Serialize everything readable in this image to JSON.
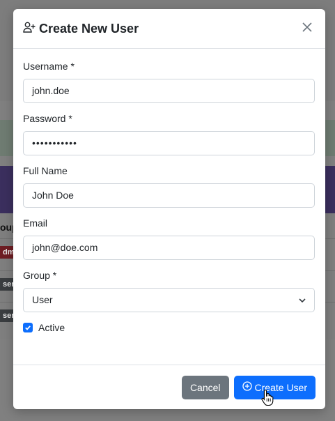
{
  "background": {
    "heading_fragment": "oup",
    "badges": [
      "dmi",
      "ser",
      "ser"
    ]
  },
  "modal": {
    "title": "Create New User",
    "title_icon": "user-plus-icon",
    "close_icon": "close-icon",
    "fields": {
      "username": {
        "label": "Username *",
        "value": "john.doe"
      },
      "password": {
        "label": "Password *",
        "value": "•••••••••••"
      },
      "full_name": {
        "label": "Full Name",
        "value": "John Doe"
      },
      "email": {
        "label": "Email",
        "value": "john@doe.com"
      },
      "group": {
        "label": "Group *",
        "selected": "User"
      }
    },
    "active": {
      "label": "Active",
      "checked": true
    },
    "footer": {
      "cancel_label": "Cancel",
      "create_label": "Create User",
      "create_icon": "plus-circle-icon"
    }
  },
  "colors": {
    "primary": "#0d6efd",
    "secondary": "#6c757d"
  }
}
